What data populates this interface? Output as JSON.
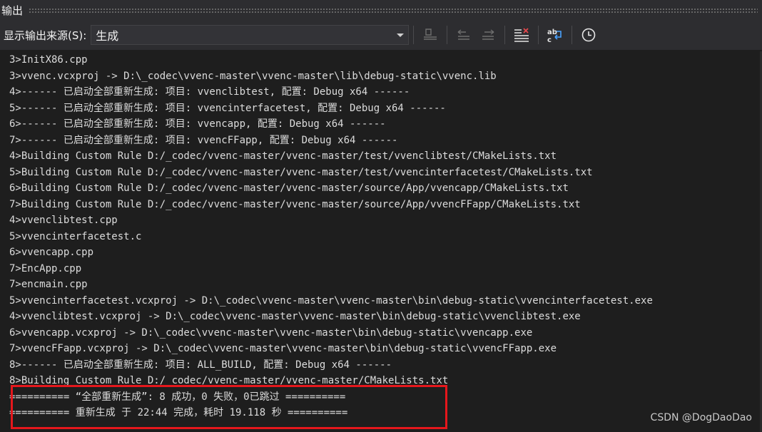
{
  "window": {
    "title": "输出"
  },
  "toolbar": {
    "source_label": "显示输出来源(S):",
    "source_selected": "生成",
    "buttons": [
      {
        "icon": "goto-source-icon",
        "enabled": false
      },
      {
        "icon": "previous-message-icon",
        "enabled": false
      },
      {
        "icon": "next-message-icon",
        "enabled": false
      },
      {
        "icon": "clear-all-icon",
        "enabled": true
      },
      {
        "icon": "word-wrap-icon",
        "enabled": true
      },
      {
        "icon": "clock-icon",
        "enabled": true
      }
    ]
  },
  "output_lines": [
    "3>InitX86.cpp",
    "3>vvenc.vcxproj -> D:\\_codec\\vvenc-master\\vvenc-master\\lib\\debug-static\\vvenc.lib",
    "4>------ 已启动全部重新生成: 项目: vvenclibtest, 配置: Debug x64 ------",
    "5>------ 已启动全部重新生成: 项目: vvencinterfacetest, 配置: Debug x64 ------",
    "6>------ 已启动全部重新生成: 项目: vvencapp, 配置: Debug x64 ------",
    "7>------ 已启动全部重新生成: 项目: vvencFFapp, 配置: Debug x64 ------",
    "4>Building Custom Rule D:/_codec/vvenc-master/vvenc-master/test/vvenclibtest/CMakeLists.txt",
    "5>Building Custom Rule D:/_codec/vvenc-master/vvenc-master/test/vvencinterfacetest/CMakeLists.txt",
    "6>Building Custom Rule D:/_codec/vvenc-master/vvenc-master/source/App/vvencapp/CMakeLists.txt",
    "7>Building Custom Rule D:/_codec/vvenc-master/vvenc-master/source/App/vvencFFapp/CMakeLists.txt",
    "4>vvenclibtest.cpp",
    "5>vvencinterfacetest.c",
    "6>vvencapp.cpp",
    "7>EncApp.cpp",
    "7>encmain.cpp",
    "5>vvencinterfacetest.vcxproj -> D:\\_codec\\vvenc-master\\vvenc-master\\bin\\debug-static\\vvencinterfacetest.exe",
    "4>vvenclibtest.vcxproj -> D:\\_codec\\vvenc-master\\vvenc-master\\bin\\debug-static\\vvenclibtest.exe",
    "6>vvencapp.vcxproj -> D:\\_codec\\vvenc-master\\vvenc-master\\bin\\debug-static\\vvencapp.exe",
    "7>vvencFFapp.vcxproj -> D:\\_codec\\vvenc-master\\vvenc-master\\bin\\debug-static\\vvencFFapp.exe",
    "8>------ 已启动全部重新生成: 项目: ALL_BUILD, 配置: Debug x64 ------",
    "8>Building Custom Rule D:/_codec/vvenc-master/vvenc-master/CMakeLists.txt",
    "========== “全部重新生成”: 8 成功，0 失败，0已跳过 ==========",
    "========== 重新生成 于 22:44 完成，耗时 19.118 秒 =========="
  ],
  "annotation": {
    "color": "#e5171c"
  },
  "watermark": "CSDN @DogDaoDao",
  "colors": {
    "background": "#1e1e1e",
    "toolbar": "#2d2d30",
    "text": "#dcdcdc"
  }
}
